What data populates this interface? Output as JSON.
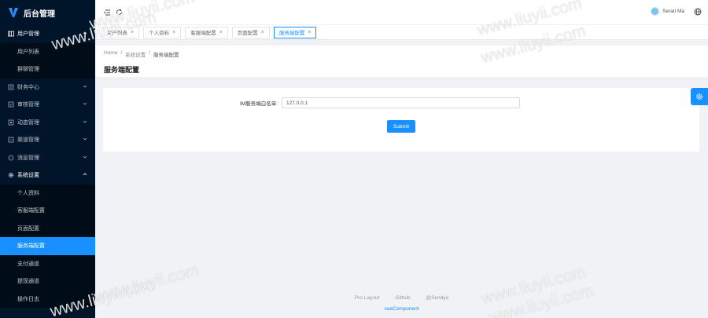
{
  "logo": {
    "text": "后台管理"
  },
  "sidebar": {
    "items": [
      {
        "label": "用户管理",
        "icon": "user-icon",
        "open": true,
        "children": [
          {
            "label": "用户列表"
          },
          {
            "label": "群聊管理"
          }
        ]
      },
      {
        "label": "财务中心",
        "icon": "wallet-icon"
      },
      {
        "label": "审核管理",
        "icon": "check-icon"
      },
      {
        "label": "动态管理",
        "icon": "feed-icon"
      },
      {
        "label": "渠道管理",
        "icon": "channel-icon"
      },
      {
        "label": "消息管理",
        "icon": "message-icon"
      },
      {
        "label": "系统设置",
        "icon": "settings-icon",
        "open": true,
        "children": [
          {
            "label": "个人资料"
          },
          {
            "label": "客服端配置"
          },
          {
            "label": "页面配置"
          },
          {
            "label": "服务端配置",
            "active": true
          },
          {
            "label": "支付通道"
          },
          {
            "label": "提现通道"
          },
          {
            "label": "操作日志"
          }
        ]
      }
    ]
  },
  "header": {
    "user_name": "Serati Ma"
  },
  "tabs": [
    {
      "label": "用户列表",
      "active": false
    },
    {
      "label": "个人资料",
      "active": false
    },
    {
      "label": "客服端配置",
      "active": false
    },
    {
      "label": "页面配置",
      "active": false
    },
    {
      "label": "服务端配置",
      "active": true
    }
  ],
  "breadcrumb": {
    "home": "Home",
    "parent": "系统设置",
    "current": "服务端配置",
    "sep": "/"
  },
  "page": {
    "title": "服务端配置"
  },
  "form": {
    "label": "IM服务端白名单:",
    "value": "127.0.0.1",
    "submit_label": "Submit"
  },
  "footer": {
    "links": [
      "Pro Layout",
      "Github",
      "@Sendya"
    ],
    "copyright": "vueComponent"
  },
  "watermark": "www.liuyii.com",
  "colors": {
    "sidebar_bg": "#001529",
    "primary": "#1890ff",
    "page_bg": "#f0f2f5"
  }
}
